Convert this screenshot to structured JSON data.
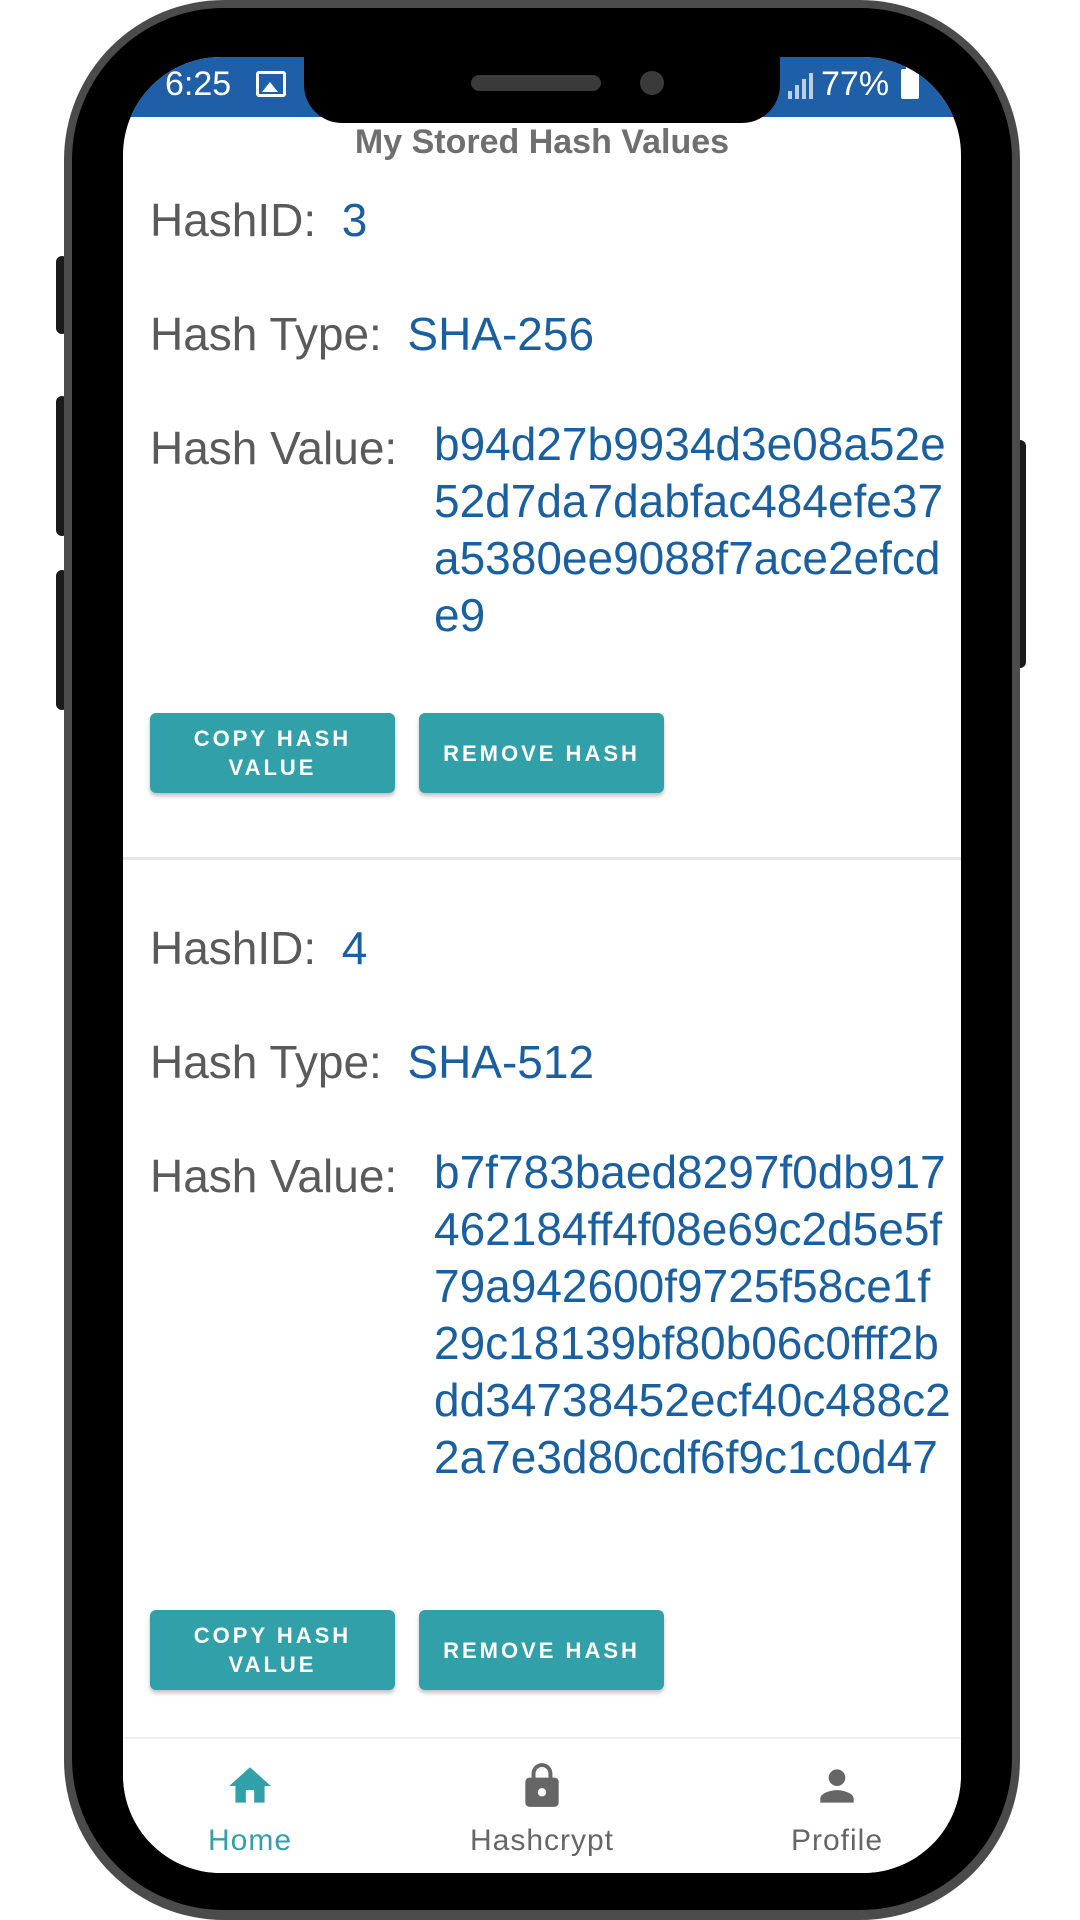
{
  "status_bar": {
    "time": "6:25",
    "battery": "77%"
  },
  "page": {
    "title": "My Stored Hash Values"
  },
  "records": [
    {
      "id_label": "HashID:",
      "id": "3",
      "type_label": "Hash Type:",
      "type": "SHA-256",
      "value_label": "Hash Value:",
      "value": "b94d27b9934d3e08a52e52d7da7dabfac484efe37a5380ee9088f7ace2efcde9",
      "copy_label": "COPY HASH VALUE",
      "remove_label": "REMOVE HASH"
    },
    {
      "id_label": "HashID:",
      "id": "4",
      "type_label": "Hash Type:",
      "type": "SHA-512",
      "value_label": "Hash Value:",
      "value": "b7f783baed8297f0db917462184ff4f08e69c2d5e5f79a942600f9725f58ce1f29c18139bf80b06c0fff2bdd34738452ecf40c488c22a7e3d80cdf6f9c1c0d47",
      "copy_label": "COPY HASH VALUE",
      "remove_label": "REMOVE HASH"
    }
  ],
  "bottom_nav": {
    "items": [
      {
        "label": "Home",
        "icon": "home-icon",
        "active": true
      },
      {
        "label": "Hashcrypt",
        "icon": "lock-icon",
        "active": false
      },
      {
        "label": "Profile",
        "icon": "person-icon",
        "active": false
      }
    ]
  },
  "colors": {
    "accent": "#32a0a8",
    "value_text": "#1a5fa0",
    "status_bar": "#1f5fa8",
    "nav_active": "#32a0a8",
    "nav_inactive": "#666666"
  }
}
